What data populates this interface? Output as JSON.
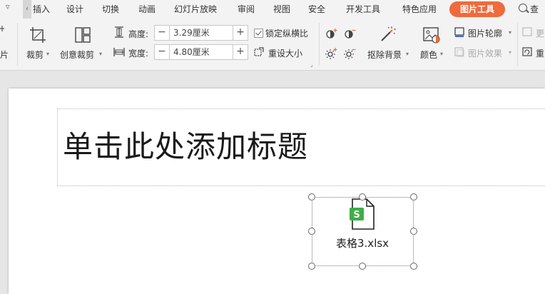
{
  "menu": {
    "tabs": [
      "插入",
      "设计",
      "切换",
      "动画",
      "幻灯片放映",
      "审阅",
      "视图",
      "安全",
      "开发工具",
      "特色应用"
    ],
    "active_tab": "图片工具",
    "search_label": "查找"
  },
  "ribbon": {
    "left_cut_label": "片",
    "crop_label": "裁剪",
    "creative_crop_label": "创意裁剪",
    "height_label": "高度:",
    "height_value": "3.29厘米",
    "width_label": "宽度:",
    "width_value": "4.80厘米",
    "lock_ratio_label": "锁定纵横比",
    "reset_size_label": "重设大小",
    "remove_bg_label": "抠除背景",
    "color_label": "颜色",
    "outline_label": "图片轮廓",
    "effects_label": "图片效果",
    "more_label": "更",
    "reset_label": "重"
  },
  "slide": {
    "title_placeholder": "单击此处添加标题",
    "object_label": "表格3.xlsx",
    "object_icon_letter": "S"
  },
  "colors": {
    "accent": "#ef6a3c",
    "excel_green": "#3fae49"
  }
}
